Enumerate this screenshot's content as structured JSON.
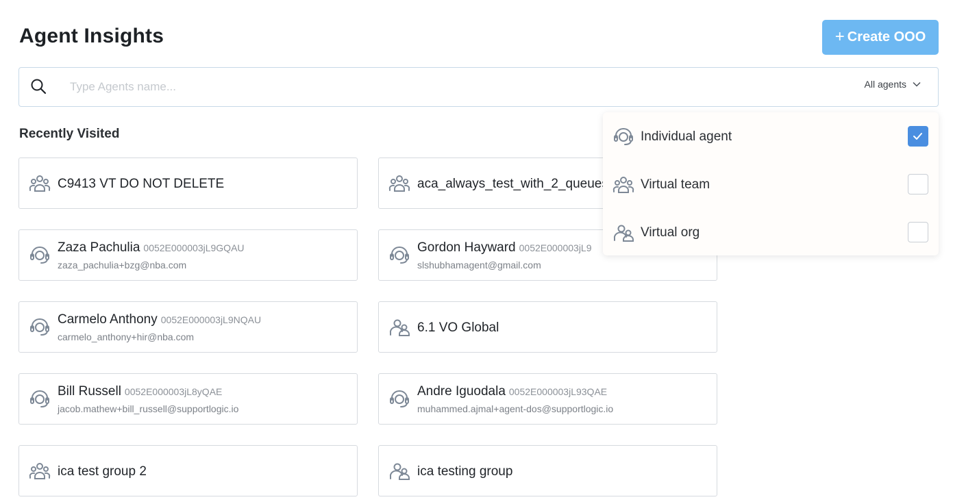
{
  "page": {
    "title": "Agent Insights"
  },
  "create_button": {
    "label": "Create OOO",
    "icon": "plus-icon"
  },
  "search": {
    "placeholder": "Type Agents name...",
    "value": "",
    "filter_label": "All agents"
  },
  "recent": {
    "title": "Recently Visited",
    "cards": [
      {
        "type": "virtual-team",
        "name": "C9413 VT DO NOT DELETE"
      },
      {
        "type": "virtual-team",
        "name": "aca_always_test_with_2_queues"
      },
      {
        "type": "individual-agent",
        "name": "Zaza Pachulia",
        "id": "0052E000003jL9GQAU",
        "email": "zaza_pachulia+bzg@nba.com"
      },
      {
        "type": "individual-agent",
        "name": "Gordon Hayward",
        "id": "0052E000003jL9",
        "email": "slshubhamagent@gmail.com"
      },
      {
        "type": "individual-agent",
        "name": "Carmelo Anthony",
        "id": "0052E000003jL9NQAU",
        "email": "carmelo_anthony+hir@nba.com"
      },
      {
        "type": "virtual-org",
        "name": "6.1 VO Global"
      },
      {
        "type": "individual-agent",
        "name": "Bill Russell",
        "id": "0052E000003jL8yQAE",
        "email": "jacob.mathew+bill_russell@supportlogic.io"
      },
      {
        "type": "individual-agent",
        "name": "Andre Iguodala",
        "id": "0052E000003jL93QAE",
        "email": "muhammed.ajmal+agent-dos@supportlogic.io"
      },
      {
        "type": "virtual-team",
        "name": "ica test group 2"
      },
      {
        "type": "virtual-org",
        "name": "ica testing group"
      }
    ]
  },
  "filter_dropdown": {
    "options": [
      {
        "label": "Individual agent",
        "icon": "headset-icon",
        "checked": true
      },
      {
        "label": "Virtual team",
        "icon": "team-icon",
        "checked": false
      },
      {
        "label": "Virtual org",
        "icon": "org-icon",
        "checked": false
      }
    ]
  },
  "colors": {
    "accent": "#6db8f2",
    "checkbox": "#4a8ee0",
    "icon": "#7d8896"
  }
}
